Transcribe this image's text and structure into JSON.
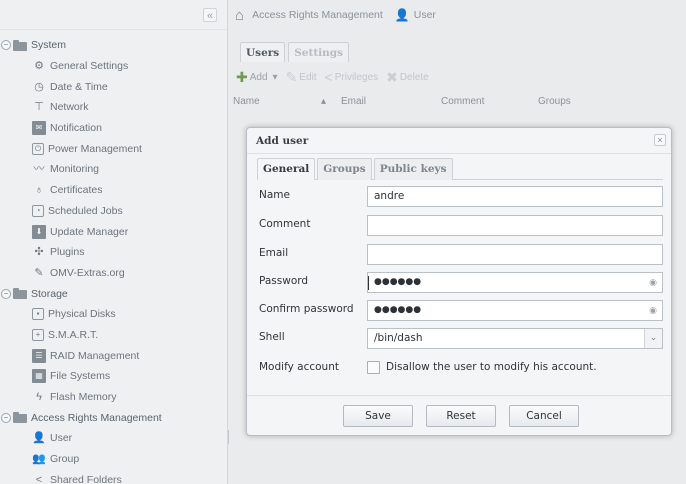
{
  "sidebar": {
    "collapse_icon": "«",
    "tree": [
      {
        "kind": "group",
        "label": "System",
        "icon": "folder-icon",
        "name": "system"
      },
      {
        "kind": "item",
        "label": "General Settings",
        "icon": "settings-gear-icon",
        "glyph": "⚙",
        "name": "general-settings"
      },
      {
        "kind": "item",
        "label": "Date & Time",
        "icon": "clock-icon",
        "glyph": "◷",
        "name": "date-time"
      },
      {
        "kind": "item",
        "label": "Network",
        "icon": "network-icon",
        "glyph": "⊤",
        "name": "network"
      },
      {
        "kind": "item",
        "label": "Notification",
        "icon": "mail-icon",
        "glyph": "✉",
        "name": "notification"
      },
      {
        "kind": "item",
        "label": "Power Management",
        "icon": "power-icon",
        "glyph": "⏻",
        "name": "power-management"
      },
      {
        "kind": "item",
        "label": "Monitoring",
        "icon": "chart-line-icon",
        "glyph": "〰",
        "name": "monitoring"
      },
      {
        "kind": "item",
        "label": "Certificates",
        "icon": "certificate-icon",
        "glyph": "♁",
        "name": "certificates"
      },
      {
        "kind": "item",
        "label": "Scheduled Jobs",
        "icon": "clock-icon",
        "glyph": "◔",
        "name": "scheduled-jobs"
      },
      {
        "kind": "item",
        "label": "Update Manager",
        "icon": "download-icon",
        "glyph": "⬇",
        "name": "update-manager"
      },
      {
        "kind": "item",
        "label": "Plugins",
        "icon": "puzzle-icon",
        "glyph": "✣",
        "name": "plugins"
      },
      {
        "kind": "item",
        "label": "OMV-Extras.org",
        "icon": "wrench-icon",
        "glyph": "✎",
        "name": "omv-extras"
      },
      {
        "kind": "group",
        "label": "Storage",
        "icon": "folder-icon",
        "name": "storage"
      },
      {
        "kind": "item",
        "label": "Physical Disks",
        "icon": "disk-icon",
        "glyph": "▪",
        "name": "physical-disks"
      },
      {
        "kind": "item",
        "label": "S.M.A.R.T.",
        "icon": "smart-icon",
        "glyph": "+",
        "name": "smart"
      },
      {
        "kind": "item",
        "label": "RAID Management",
        "icon": "raid-icon",
        "glyph": "☰",
        "name": "raid-management"
      },
      {
        "kind": "item",
        "label": "File Systems",
        "icon": "filesystem-icon",
        "glyph": "▦",
        "name": "file-systems"
      },
      {
        "kind": "item",
        "label": "Flash Memory",
        "icon": "lightning-icon",
        "glyph": "ϟ",
        "name": "flash-memory"
      },
      {
        "kind": "group",
        "label": "Access Rights Management",
        "icon": "folder-icon",
        "name": "access-rights-management"
      },
      {
        "kind": "item",
        "label": "User",
        "icon": "user-icon",
        "glyph": "👤",
        "name": "user"
      },
      {
        "kind": "item",
        "label": "Group",
        "icon": "group-icon",
        "glyph": "👥",
        "name": "group"
      },
      {
        "kind": "item",
        "label": "Shared Folders",
        "icon": "share-icon",
        "glyph": "<",
        "name": "shared-folders"
      }
    ]
  },
  "breadcrumb": {
    "home_icon": "⌂",
    "section": "Access Rights Management",
    "user_icon": "👤",
    "page": "User"
  },
  "main_tabs": [
    {
      "label": "Users",
      "active": true
    },
    {
      "label": "Settings",
      "active": false
    }
  ],
  "toolbar": {
    "add": {
      "label": "Add",
      "icon": "plus-icon",
      "glyph": "✚"
    },
    "add_dropdown": "▾",
    "edit": {
      "label": "Edit",
      "icon": "edit-icon",
      "glyph": "✎"
    },
    "privileges": {
      "label": "Privileges",
      "icon": "share-icon",
      "glyph": "<"
    },
    "delete": {
      "label": "Delete",
      "icon": "delete-icon",
      "glyph": "✖"
    }
  },
  "grid_columns": [
    "Name",
    "Email",
    "Comment",
    "Groups"
  ],
  "grid_sort_indicator": "▴",
  "dialog": {
    "title": "Add user",
    "close_icon": "×",
    "tabs": [
      {
        "label": "General",
        "active": true
      },
      {
        "label": "Groups",
        "active": false
      },
      {
        "label": "Public keys",
        "active": false
      }
    ],
    "fields": {
      "name_label": "Name",
      "name_value": "andre",
      "comment_label": "Comment",
      "comment_value": "",
      "email_label": "Email",
      "email_value": "",
      "password_label": "Password",
      "password_value": "●●●●●●",
      "confirm_label": "Confirm password",
      "confirm_value": "●●●●●●",
      "shell_label": "Shell",
      "shell_value": "/bin/dash",
      "modify_label": "Modify account",
      "modify_checkbox_label": "Disallow the user to modify his account.",
      "modify_checked": false
    },
    "eye_icon": "◉",
    "select_arrow": "⌄",
    "buttons": {
      "save": "Save",
      "reset": "Reset",
      "cancel": "Cancel"
    }
  }
}
